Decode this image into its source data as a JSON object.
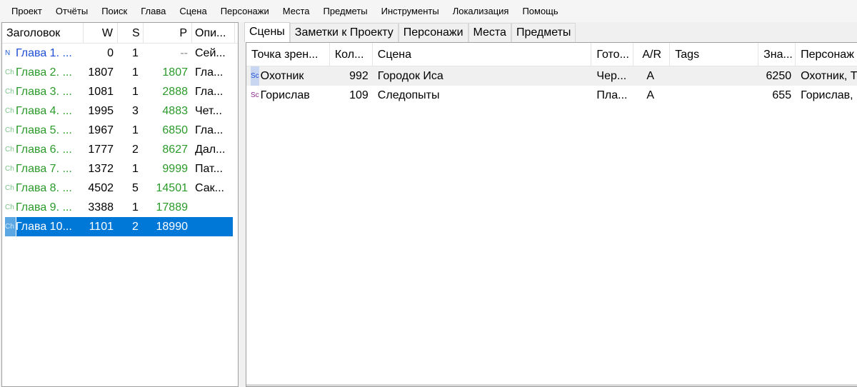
{
  "menu": [
    "Проект",
    "Отчёты",
    "Поиск",
    "Глава",
    "Сцена",
    "Персонажи",
    "Места",
    "Предметы",
    "Инструменты",
    "Локализация",
    "Помощь"
  ],
  "tree": {
    "columns": [
      "Заголовок",
      "W",
      "S",
      "P",
      "Опи..."
    ],
    "rows": [
      {
        "icon": "N",
        "title": "Глава 1. ...",
        "words": "0",
        "scenes": "1",
        "pages": "--",
        "desc": "Сей..."
      },
      {
        "icon": "Ch",
        "title": "Глава 2. ...",
        "words": "1807",
        "scenes": "1",
        "pages": "1807",
        "desc": "Гла..."
      },
      {
        "icon": "Ch",
        "title": "Глава 3. ...",
        "words": "1081",
        "scenes": "1",
        "pages": "2888",
        "desc": "Гла..."
      },
      {
        "icon": "Ch",
        "title": "Глава 4. ...",
        "words": "1995",
        "scenes": "3",
        "pages": "4883",
        "desc": "Чет..."
      },
      {
        "icon": "Ch",
        "title": "Глава 5. ...",
        "words": "1967",
        "scenes": "1",
        "pages": "6850",
        "desc": "Гла..."
      },
      {
        "icon": "Ch",
        "title": "Глава 6. ...",
        "words": "1777",
        "scenes": "2",
        "pages": "8627",
        "desc": "Дал..."
      },
      {
        "icon": "Ch",
        "title": "Глава 7. ...",
        "words": "1372",
        "scenes": "1",
        "pages": "9999",
        "desc": "Пат..."
      },
      {
        "icon": "Ch",
        "title": "Глава 8. ...",
        "words": "4502",
        "scenes": "5",
        "pages": "14501",
        "desc": "Сак..."
      },
      {
        "icon": "Ch",
        "title": "Глава 9. ...",
        "words": "3388",
        "scenes": "1",
        "pages": "17889",
        "desc": ""
      },
      {
        "icon": "Ch",
        "title": "Глава 10...",
        "words": "1101",
        "scenes": "2",
        "pages": "18990",
        "desc": ""
      }
    ]
  },
  "tabs": [
    "Сцены",
    "Заметки к Проекту",
    "Персонажи",
    "Места",
    "Предметы"
  ],
  "scenes": {
    "columns": [
      "Точка зрен...",
      "Кол...",
      "Сцена",
      "Гото...",
      "A/R",
      "Tags",
      "Зна...",
      "Персонаж"
    ],
    "rows": [
      {
        "icon": "Sc",
        "pov": "Охотник",
        "count": "992",
        "scene": "Городок Иса",
        "ready": "Чер...",
        "ar": "A",
        "tags": "",
        "chars": "6250",
        "persons": "Охотник, Т"
      },
      {
        "icon": "Sc",
        "pov": "Горислав",
        "count": "109",
        "scene": "Следопыты",
        "ready": "Пла...",
        "ar": "A",
        "tags": "",
        "chars": "655",
        "persons": "Горислав,"
      }
    ]
  }
}
